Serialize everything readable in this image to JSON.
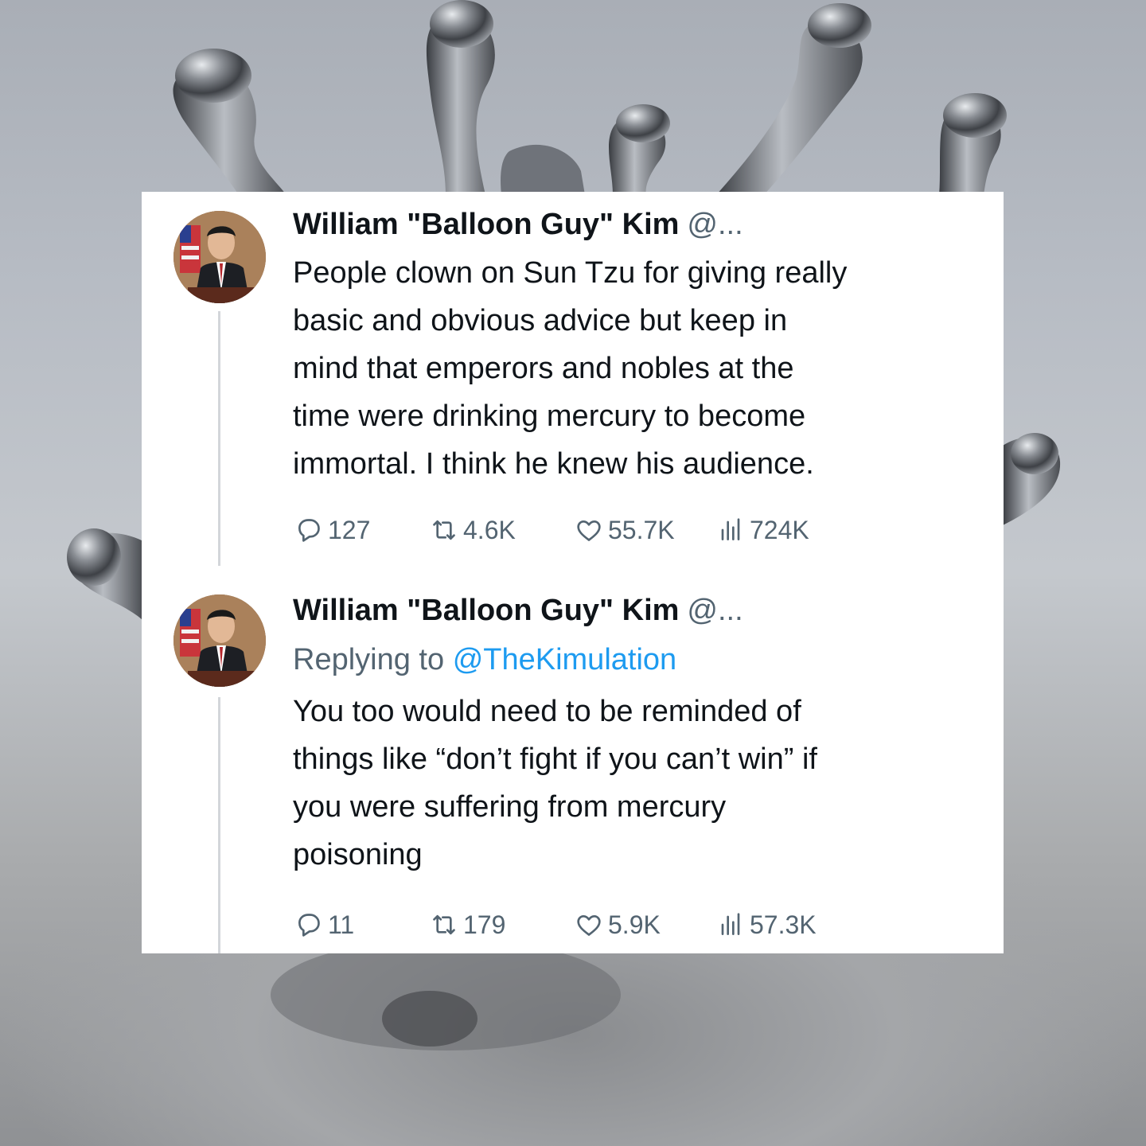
{
  "tweets": [
    {
      "author_name": "William \"Balloon Guy\" Kim",
      "author_handle": "@...",
      "text_lines": [
        "People clown on Sun Tzu for giving really",
        "basic and obvious advice but keep in",
        "mind that emperors and nobles at the",
        "time were drinking mercury to become",
        "immortal. I think he knew his audience."
      ],
      "replies": "127",
      "reposts": "4.6K",
      "likes": "55.7K",
      "views": "724K"
    },
    {
      "author_name": "William \"Balloon Guy\" Kim",
      "author_handle": "@...",
      "replying_prefix": "Replying to",
      "replying_handle": "@TheKimulation",
      "text_lines": [
        "You too would need to be reminded of",
        "things like “don’t fight if you can’t win” if",
        "you were suffering from mercury",
        "poisoning"
      ],
      "replies": "11",
      "reposts": "179",
      "likes": "5.9K",
      "views": "57.3K"
    }
  ],
  "icons": {
    "avatar": "avatar-photo",
    "reply": "reply-icon",
    "repost": "repost-icon",
    "like": "like-icon",
    "views": "views-icon"
  },
  "colors": {
    "text": "#0f1419",
    "secondary": "#536471",
    "link": "#1d9bf0",
    "card": "#ffffff"
  }
}
